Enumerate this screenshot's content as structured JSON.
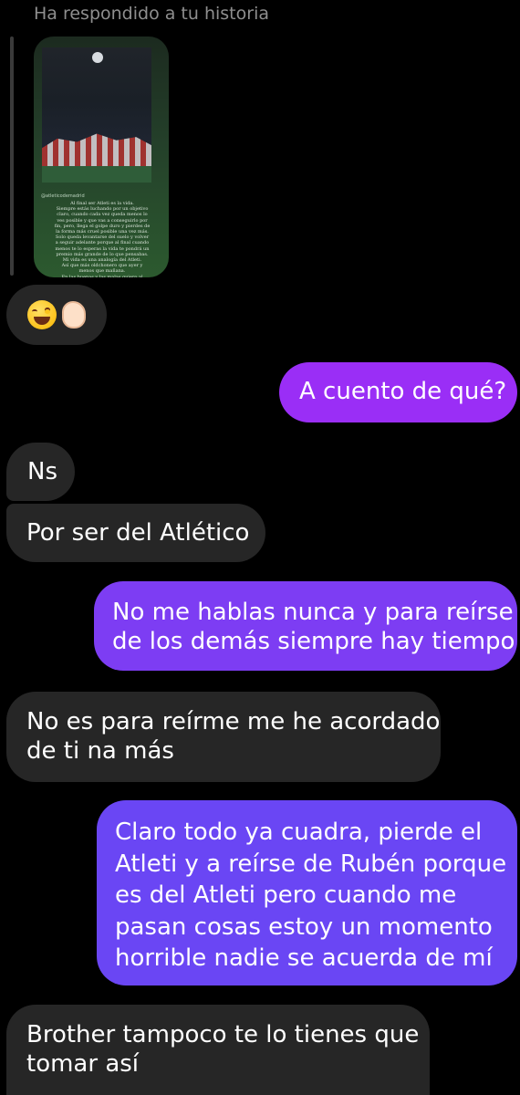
{
  "story_reply": {
    "header": "Ha respondido a tu historia",
    "author": "@atleticodemadrid",
    "text": "Al final ser Atleti es la vida.\nSiempre estás luchando por un objetivo\nclaro, cuando cada vez queda menos lo\nves posible y que vas a conseguirlo por\nfin, pero, llega el golpe duro y pierdes de\nla forma más cruel posible una vez más.\nSolo queda levantarse del suelo y volver\na seguir adelante porque al final cuando\nmenos te lo esperas la vida te pondrá un\npremio más grande de lo que pensabas.\nMi vida es una analogía del Atleti.\nAsí que más oldchonero que ayer y\nmenos que mañana.\nEn las buenas y las malas quiero al\nAtleti. Aúpa Atleti ❤️🤍"
  },
  "messages": {
    "emoji_reply": "😂👌🏻",
    "sent_1": "A cuento de qué?",
    "recv_ns": "Ns",
    "recv_atletico": "Por ser del Atlético",
    "sent_2": "No me hablas nunca y para reírse\nde los demás siempre hay tiempo",
    "recv_reirme": "No es para reírme me he acordado\nde ti na más",
    "sent_3": "Claro todo ya cuadra, pierde el\nAtleti y a reírse de Rubén porque\nes del Atleti pero cuando me\npasan cosas estoy un momento\nhorrible nadie se acuerda de mí",
    "recv_brother": "Brother tampoco te lo tienes que\ntomar así"
  },
  "colors": {
    "background": "#000000",
    "received_bubble": "#262626",
    "sent_gradient": [
      "#9a2ef6",
      "#7d3df3",
      "#6a46f4"
    ]
  },
  "icons": {
    "emoji_1": "face-with-tears-of-joy",
    "emoji_2": "ok-hand-light-skin"
  }
}
